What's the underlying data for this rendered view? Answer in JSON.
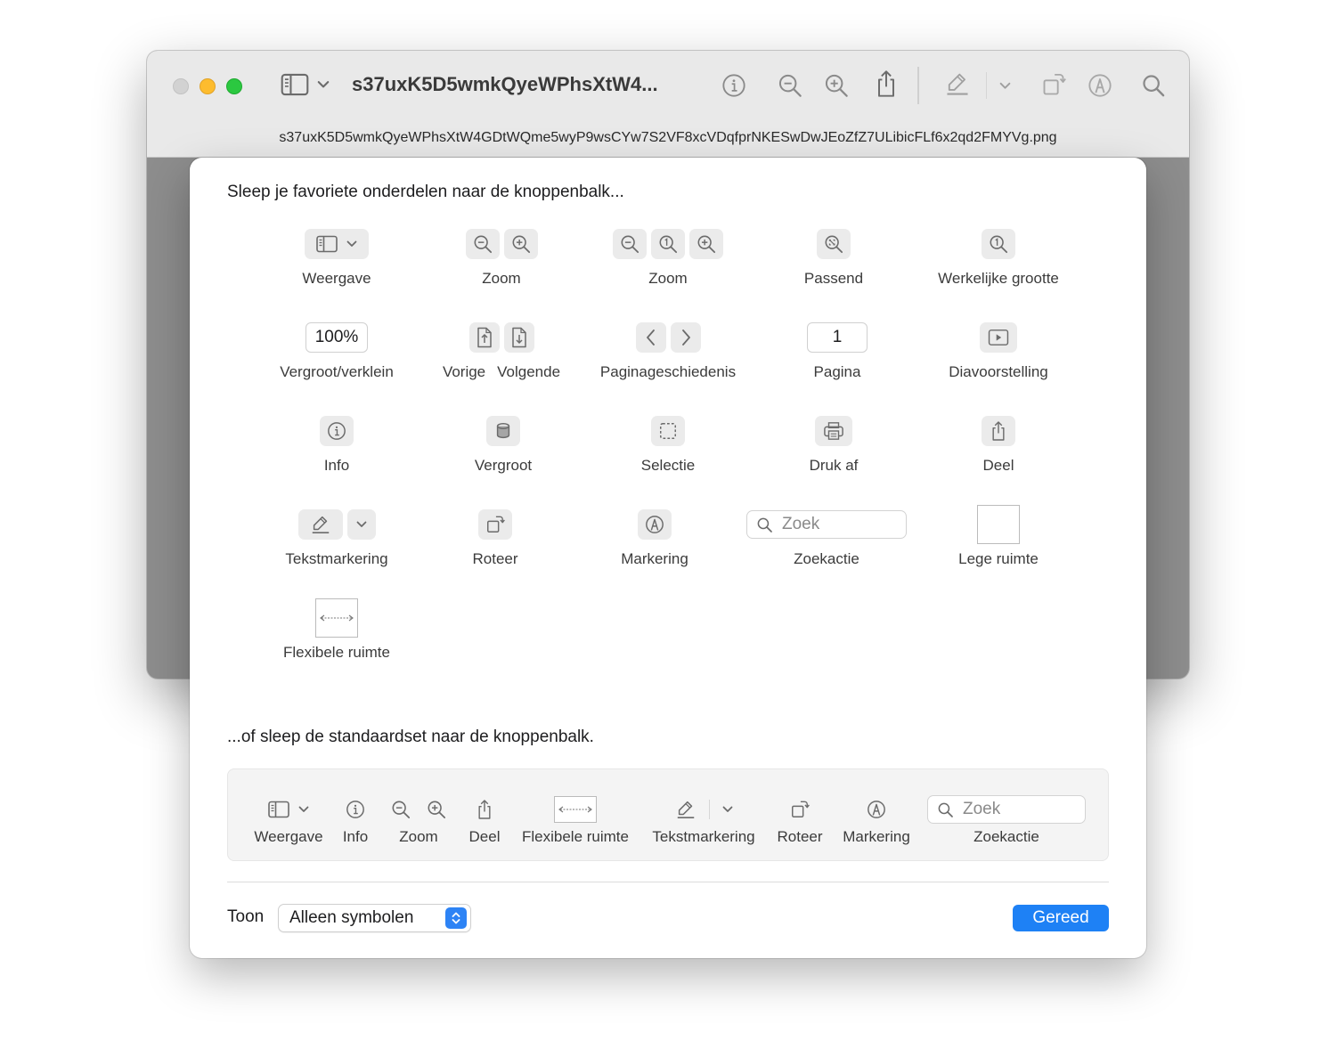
{
  "window": {
    "title": "s37uxK5D5wmkQyeWPhsXtW4...",
    "filename": "s37uxK5D5wmkQyeWPhsXtW4GDtWQme5wyP9wsCYw7S2VF8xcVDqfprNKESwDwJEoZfZ7ULibicFLf6x2qd2FMYVg.png"
  },
  "sheet": {
    "heading": "Sleep je favoriete onderdelen naar de knoppenbalk...",
    "palette": {
      "view": "Weergave",
      "zoom_pair": "Zoom",
      "zoom_triple": "Zoom",
      "fit": "Passend",
      "actual_size": "Werkelijke grootte",
      "scale_value": "100%",
      "scale": "Vergroot/verklein",
      "previous": "Vorige",
      "next": "Volgende",
      "page_history": "Paginageschiedenis",
      "page_value": "1",
      "page": "Pagina",
      "slideshow": "Diavoorstelling",
      "info": "Info",
      "magnify": "Vergroot",
      "selection": "Selectie",
      "print": "Druk af",
      "share": "Deel",
      "highlight": "Tekstmarkering",
      "rotate": "Roteer",
      "markup": "Markering",
      "search_placeholder": "Zoek",
      "search": "Zoekactie",
      "space": "Lege ruimte",
      "flexible_space": "Flexibele ruimte"
    },
    "default_heading": "...of sleep de standaardset naar de knoppenbalk.",
    "default_set": {
      "view": "Weergave",
      "info": "Info",
      "zoom": "Zoom",
      "share": "Deel",
      "flexible_space": "Flexibele ruimte",
      "highlight": "Tekstmarkering",
      "rotate": "Roteer",
      "markup": "Markering",
      "search_placeholder": "Zoek",
      "search": "Zoekactie"
    },
    "show_label": "Toon",
    "show_value": "Alleen symbolen",
    "done": "Gereed"
  },
  "colors": {
    "accent": "#1e81f5",
    "close": "#d2d2d2",
    "minimize": "#fdbc2e",
    "maximize": "#2bc840"
  },
  "icons": [
    "sidebar-icon",
    "chevron-down-icon",
    "info-icon",
    "zoom-out-icon",
    "zoom-in-icon",
    "share-icon",
    "highlighter-icon",
    "rotate-icon",
    "markup-icon",
    "search-icon",
    "actual-size-icon",
    "fit-icon",
    "page-up-icon",
    "page-down-icon",
    "chevron-left-icon",
    "chevron-right-icon",
    "slideshow-icon",
    "magnifier-icon",
    "selection-icon",
    "print-icon"
  ]
}
